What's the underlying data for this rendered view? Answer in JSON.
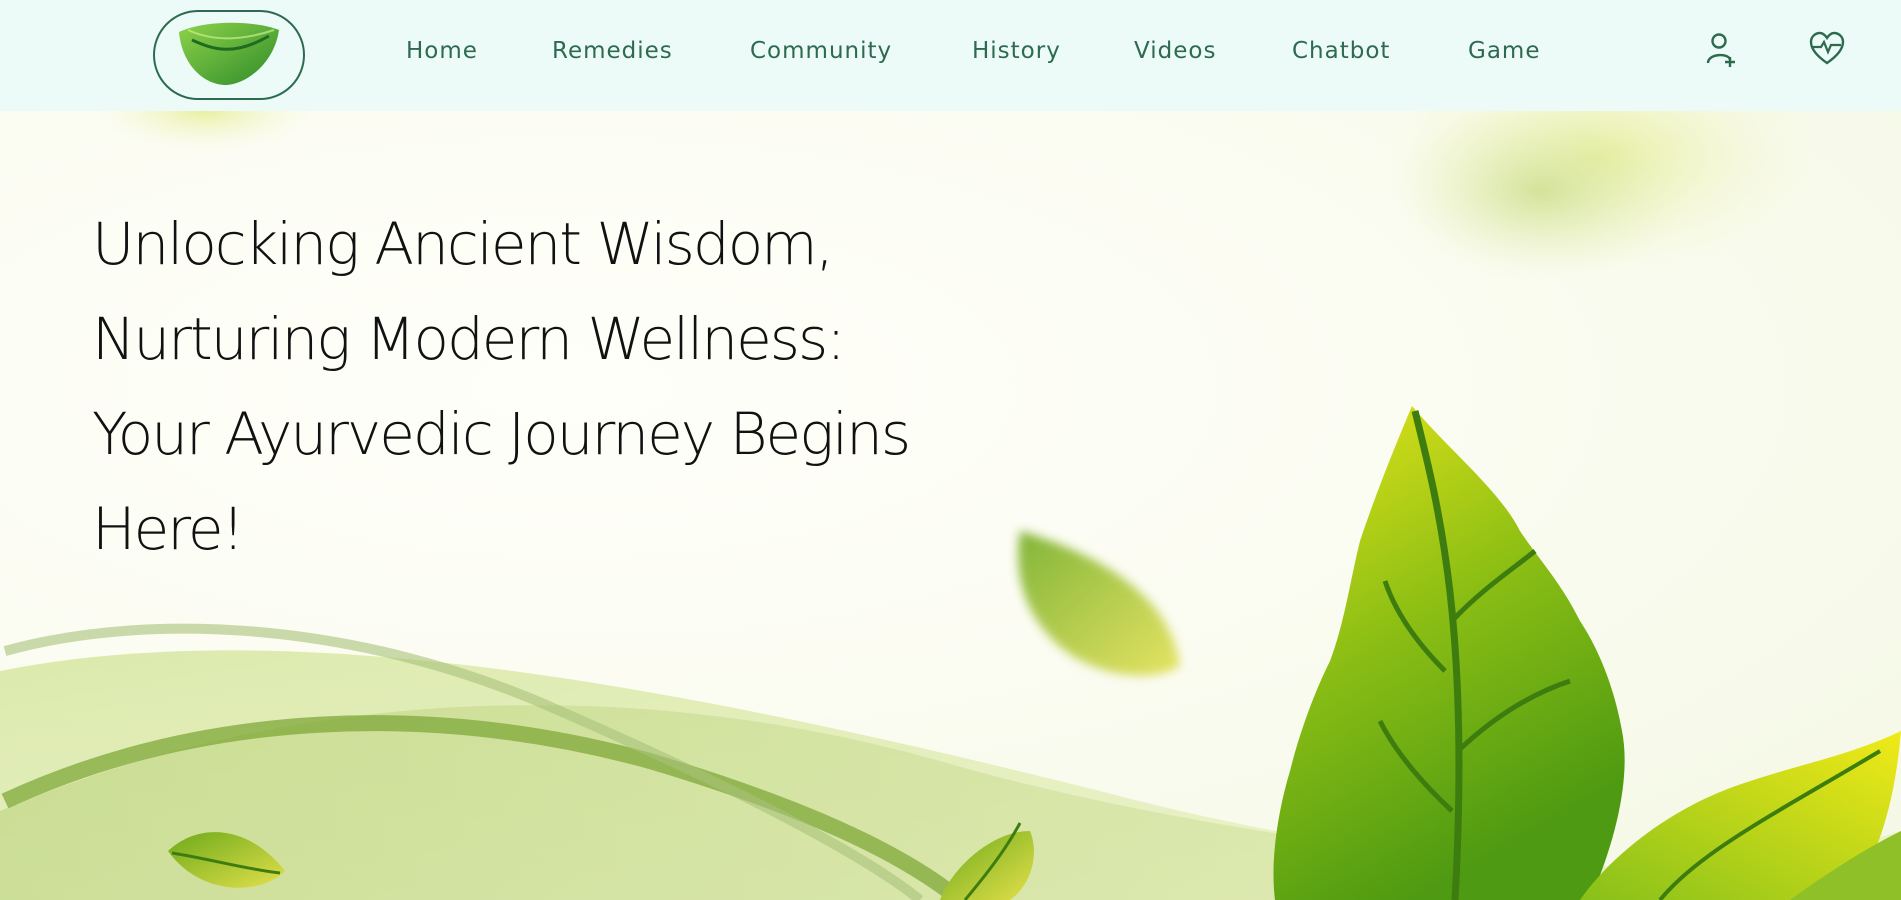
{
  "header": {
    "logo": {
      "icon": "leaf-icon",
      "color": "#3f9b2e"
    },
    "nav": [
      {
        "label": "Home"
      },
      {
        "label": "Remedies"
      },
      {
        "label": "Community"
      },
      {
        "label": "History"
      },
      {
        "label": "Videos"
      },
      {
        "label": "Chatbot"
      },
      {
        "label": "Game"
      }
    ],
    "actions": [
      {
        "icon": "user-add-icon"
      },
      {
        "icon": "heart-pulse-icon"
      }
    ],
    "colors": {
      "background": "#ecfbf8",
      "accent": "#2d6a4f"
    }
  },
  "hero": {
    "headline": [
      "Unlocking Ancient Wisdom,",
      "Nurturing Modern Wellness:",
      "Your Ayurvedic Journey Begins",
      "Here!"
    ],
    "colors": {
      "leaf_light": "#d9e86a",
      "leaf_mid": "#8cbf1f",
      "leaf_dark": "#3f8a12"
    }
  }
}
